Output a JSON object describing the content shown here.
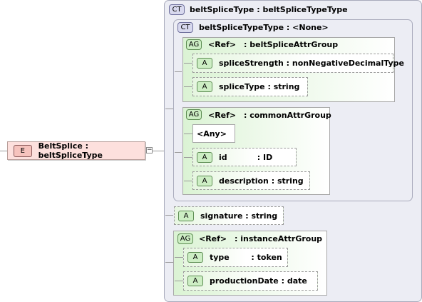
{
  "element": {
    "badge": "E",
    "name": "BeltSplice",
    "sep": ":",
    "type": "beltSpliceType",
    "collapse_glyph": "−"
  },
  "outer_type": {
    "badge": "CT",
    "label": "beltSpliceType : beltSpliceTypeType"
  },
  "inner_type": {
    "badge": "CT",
    "label": "beltSpliceTypeType : <None>"
  },
  "groups": [
    {
      "badge": "AG",
      "ref": "<Ref>",
      "name": ": beltSpliceAttrGroup",
      "attributes": [
        {
          "badge": "A",
          "label": "spliceStrength : nonNegativeDecimalType"
        },
        {
          "badge": "A",
          "label": "spliceType : string"
        }
      ]
    },
    {
      "badge": "AG",
      "ref": "<Ref>",
      "name": ": commonAttrGroup",
      "any": "<Any>",
      "attributes": [
        {
          "badge": "A",
          "label": "id           : ID"
        },
        {
          "badge": "A",
          "label": "description : string"
        }
      ]
    },
    {
      "badge": "AG",
      "ref": "<Ref>",
      "name": ": instanceAttrGroup",
      "attributes": [
        {
          "badge": "A",
          "label": "type        : token"
        },
        {
          "badge": "A",
          "label": "productionDate : date"
        }
      ]
    }
  ],
  "signature": {
    "badge": "A",
    "label": "signature : string"
  }
}
